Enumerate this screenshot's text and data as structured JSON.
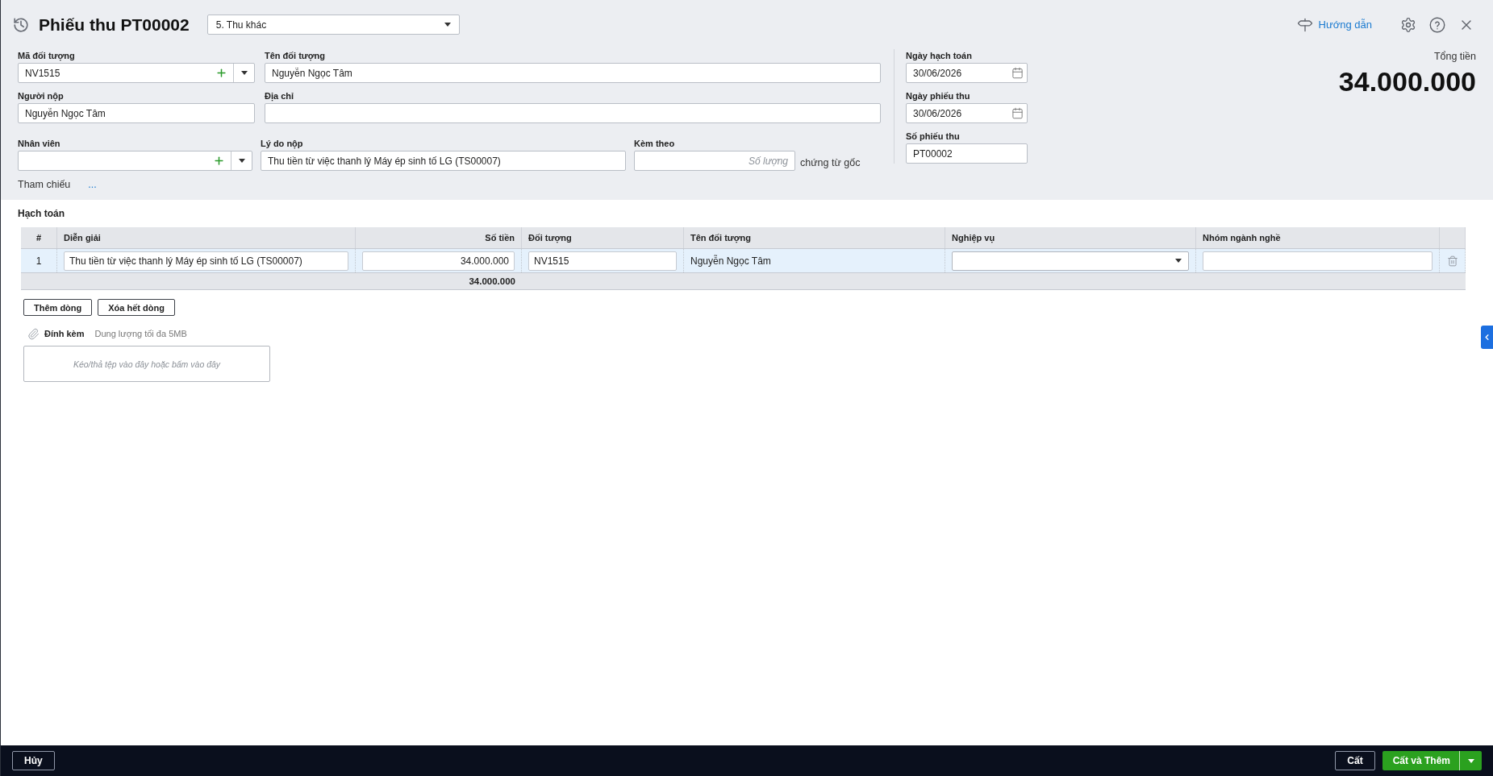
{
  "header": {
    "title": "Phiếu thu PT00002",
    "voucher_type": "5. Thu khác",
    "guide_link": "Hướng dẫn"
  },
  "form": {
    "rows": [
      [
        {
          "label": "Mã đối tượng",
          "kind": "lookup",
          "value": "NV1515"
        },
        {
          "label": "Tên đối tượng",
          "kind": "text",
          "value": "Nguyễn Ngọc Tâm"
        }
      ],
      [
        {
          "label": "Người nộp",
          "kind": "text",
          "value": "Nguyễn Ngọc Tâm"
        },
        {
          "label": "Địa chỉ",
          "kind": "text"
        }
      ],
      [
        {
          "label": "Nhân viên",
          "kind": "lookup"
        },
        {
          "label": "Lý do nộp",
          "kind": "text",
          "value": "Thu tiền từ việc thanh lý Máy ép sinh tố LG (TS00007)"
        },
        {
          "label": "Kèm theo",
          "kind": "quantity",
          "placeholder": "Số lượng",
          "suffix": "chứng từ gốc"
        }
      ]
    ],
    "reference": {
      "label": "Tham chiếu",
      "action": "..."
    }
  },
  "dates": [
    {
      "label": "Ngày hạch toán",
      "kind": "date",
      "value": "30/06/2026"
    },
    {
      "label": "Ngày phiếu thu",
      "kind": "date",
      "value": "30/06/2026"
    },
    {
      "label": "Số phiếu thu",
      "kind": "text",
      "value": "PT00002"
    }
  ],
  "total": {
    "label": "Tổng tiền",
    "value": "34.000.000"
  },
  "accounting": {
    "title": "Hạch toán",
    "columns": [
      {
        "label": "#",
        "kind": "index"
      },
      {
        "label": "Diễn giải",
        "kind": "input"
      },
      {
        "label": "Số tiền",
        "kind": "amount"
      },
      {
        "label": "Đối tượng",
        "kind": "input"
      },
      {
        "label": "Tên đối tượng",
        "kind": "text"
      },
      {
        "label": "Nghiệp vụ",
        "kind": "select"
      },
      {
        "label": "Nhóm ngành nghề",
        "kind": "input"
      }
    ],
    "rows": [
      {
        "selected": true,
        "cells": [
          "1",
          "Thu tiền từ việc thanh lý Máy ép sinh tố LG (TS00007)",
          "34.000.000",
          "NV1515",
          "Nguyễn Ngọc Tâm"
        ]
      }
    ],
    "total": "34.000.000",
    "buttons": [
      "Thêm dòng",
      "Xóa hết dòng"
    ]
  },
  "attachment": {
    "label": "Đính kèm",
    "hint": "Dung lượng tối đa 5MB",
    "dropzone": "Kéo/thả tệp vào đây hoặc bấm vào đây"
  },
  "footer": {
    "left": [
      {
        "label": "Hủy",
        "kind": "outline"
      }
    ],
    "right": [
      {
        "label": "Cất",
        "kind": "outline"
      },
      {
        "label": "Cất và Thêm",
        "kind": "split"
      }
    ]
  }
}
